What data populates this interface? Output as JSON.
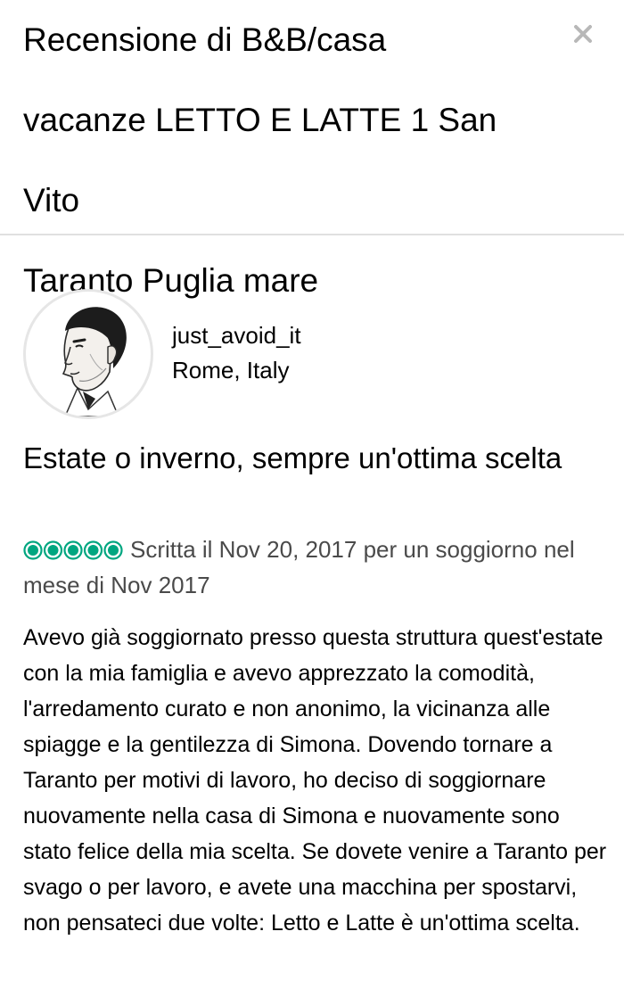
{
  "header": {
    "title": "Recensione di B&B/casa\nvacanze LETTO E LATTE 1 San Vito\nTaranto Puglia mare",
    "close_icon": "close-icon"
  },
  "review": {
    "avatar_icon": "avatar-portrait",
    "username": "just_avoid_it",
    "location": "Rome, Italy",
    "title": "Estate o inverno, sempre un'ottima scelta",
    "rating": 5,
    "rating_max": 5,
    "rating_color": "#00a680",
    "date_text": "Scritta il Nov 20, 2017 per un soggiorno nel mese di Nov 2017",
    "body": "Avevo già soggiornato presso questa struttura quest'estate con la mia famiglia e avevo apprezzato la comodità, l'arredamento curato e non anonimo, la vicinanza alle spiagge e la gentilezza di Simona. Dovendo tornare a Taranto per motivi di lavoro, ho deciso di soggiornare nuovamente nella casa di Simona e nuovamente sono stato felice della mia scelta. Se dovete venire a Taranto per svago o per lavoro, e avete una macchina per spostarvi, non pensateci due volte: Letto e Latte è un'ottima scelta."
  }
}
